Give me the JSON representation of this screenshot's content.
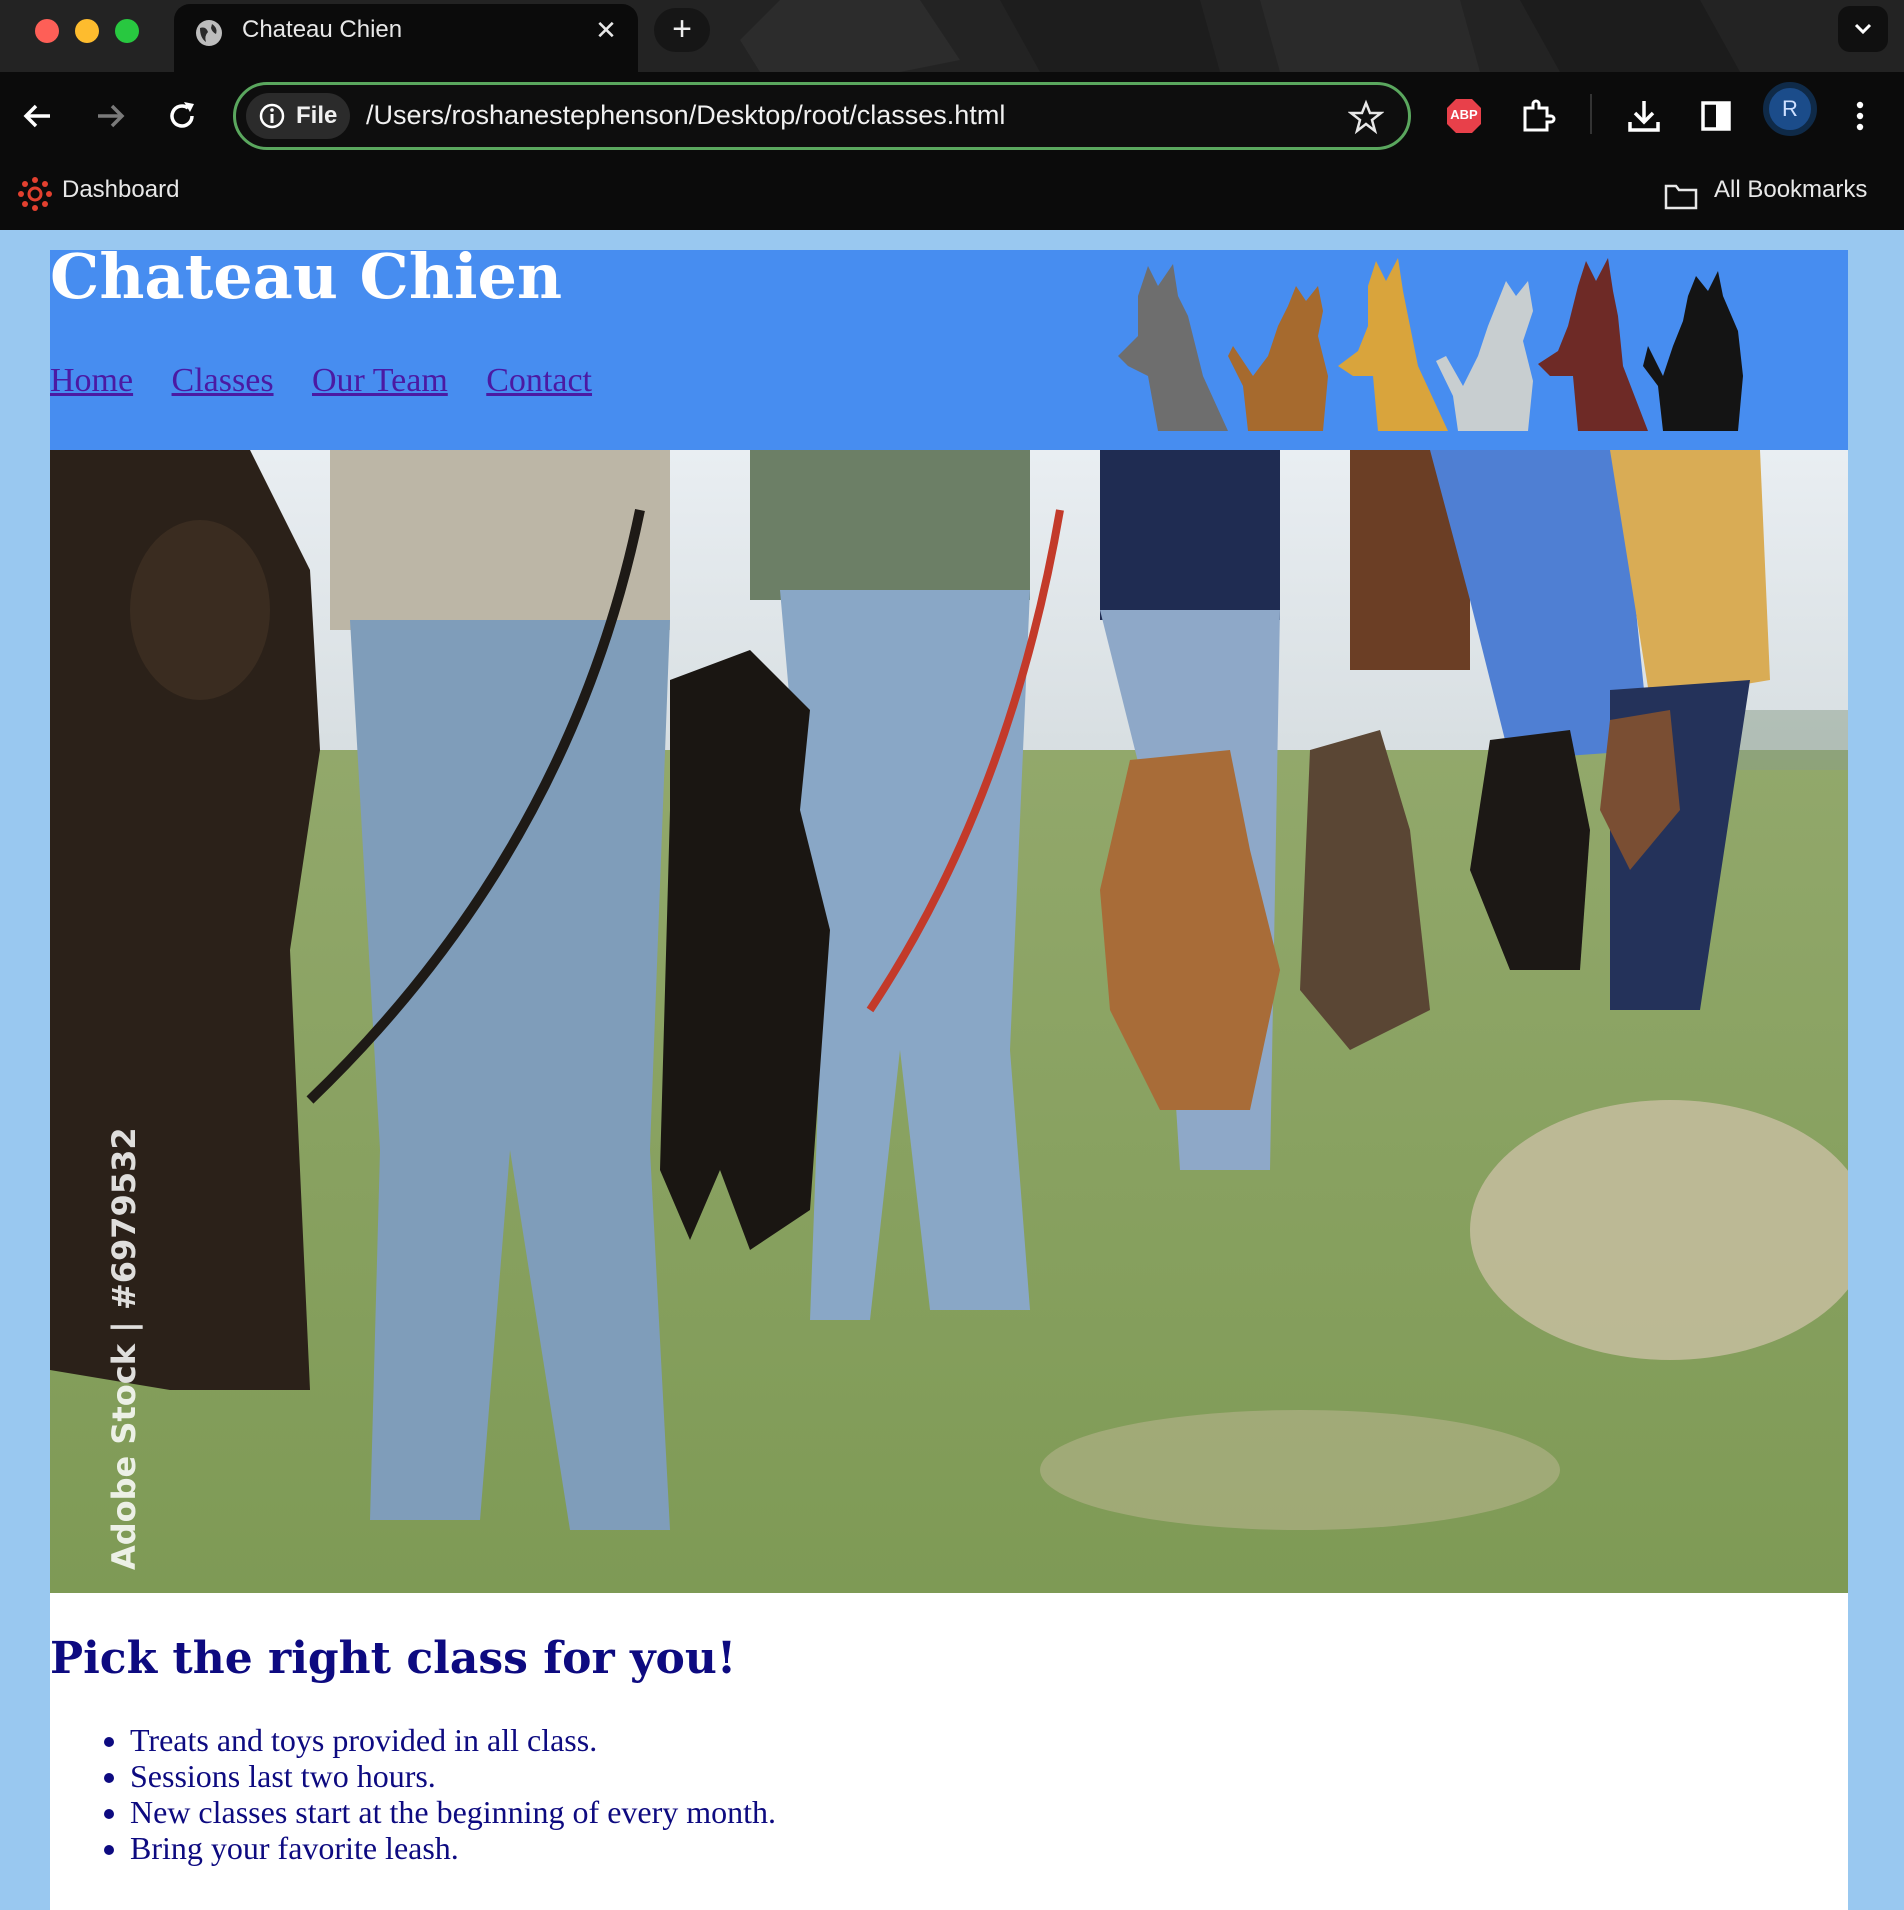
{
  "browser": {
    "tab": {
      "title": "Chateau Chien",
      "close_symbol": "✕",
      "favicon": "globe-icon"
    },
    "new_tab_symbol": "+",
    "omnibox": {
      "chip_label": "File",
      "url": "/Users/roshanestephenson/Desktop/root/classes.html"
    },
    "toolbar_icons": [
      "back-icon",
      "forward-icon",
      "reload-icon",
      "info-icon",
      "star-icon",
      "adblock-icon",
      "extensions-icon",
      "download-icon",
      "side-panel-icon",
      "menu-icon"
    ],
    "avatar_initial": "R",
    "bookmarks": {
      "dashboard": "Dashboard",
      "all_bookmarks": "All Bookmarks"
    },
    "adblock_label": "ABP"
  },
  "site": {
    "title": "Chateau Chien",
    "nav": [
      "Home",
      "Classes",
      "Our Team",
      "Contact"
    ],
    "hero_watermark": "Adobe Stock | #6979532",
    "section_title": "Pick the right class for you!",
    "class_points": [
      "Treats and toys provided in all class.",
      "Sessions last two hours.",
      "New classes start at the beginning of every month.",
      "Bring your favorite leash."
    ]
  },
  "colors": {
    "page_background": "#99c8f0",
    "header_background": "#478df0",
    "nav_link": "#4b1aa3",
    "heading_text": "#0d0a80",
    "omnibox_border": "#5aa75e",
    "pet_silhouettes": [
      "#6e6e6e",
      "#a66a2e",
      "#d9a43c",
      "#c8ced0",
      "#6e2a26",
      "#141414"
    ]
  }
}
